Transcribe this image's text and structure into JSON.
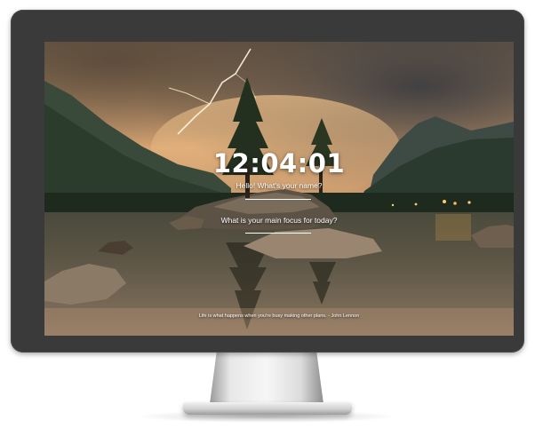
{
  "clock": {
    "time": "12:04:01"
  },
  "greeting": {
    "text": "Hello! What's your name?"
  },
  "focus": {
    "question": "What is your main focus for today?"
  },
  "quote": {
    "text": "Life is what happens when you're busy making other plans. - John Lennon"
  },
  "background": {
    "icon": "landscape-lake-mountains-lightning"
  }
}
